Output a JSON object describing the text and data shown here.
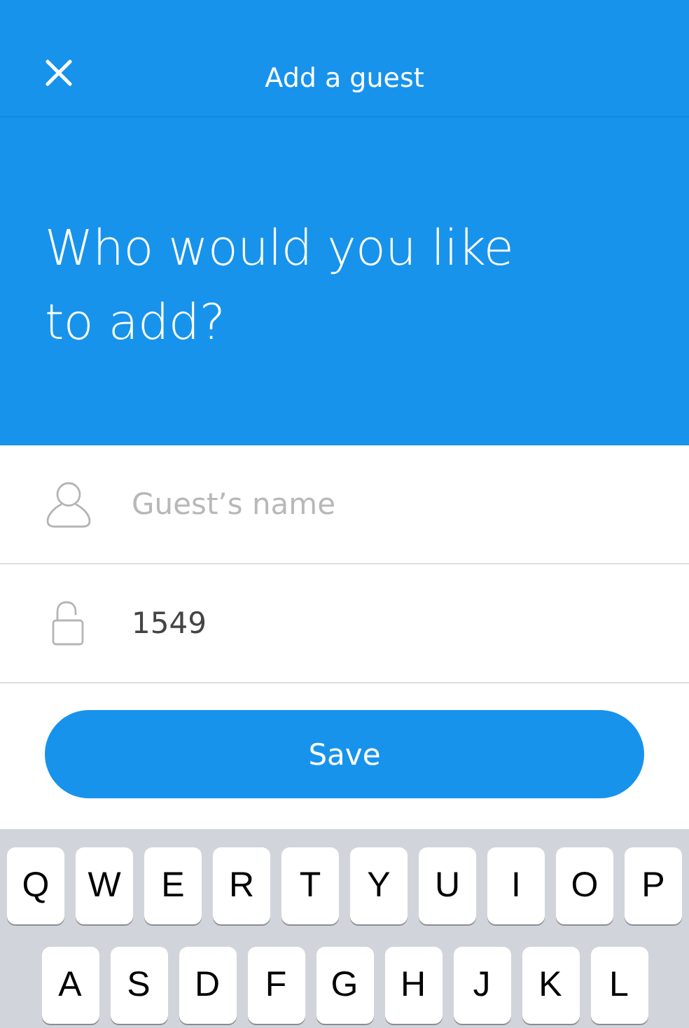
{
  "header": {
    "title": "Add a guest"
  },
  "heading": "Who would you like to add?",
  "fields": [
    {
      "kind": "name",
      "placeholder": "Guest’s name"
    },
    {
      "kind": "code",
      "value": "1549"
    }
  ],
  "save_button": "Save",
  "keyboard": {
    "rows": [
      [
        "Q",
        "W",
        "E",
        "R",
        "T",
        "Y",
        "U",
        "I",
        "O",
        "P"
      ],
      [
        "A",
        "S",
        "D",
        "F",
        "G",
        "H",
        "J",
        "K",
        "L"
      ]
    ]
  }
}
